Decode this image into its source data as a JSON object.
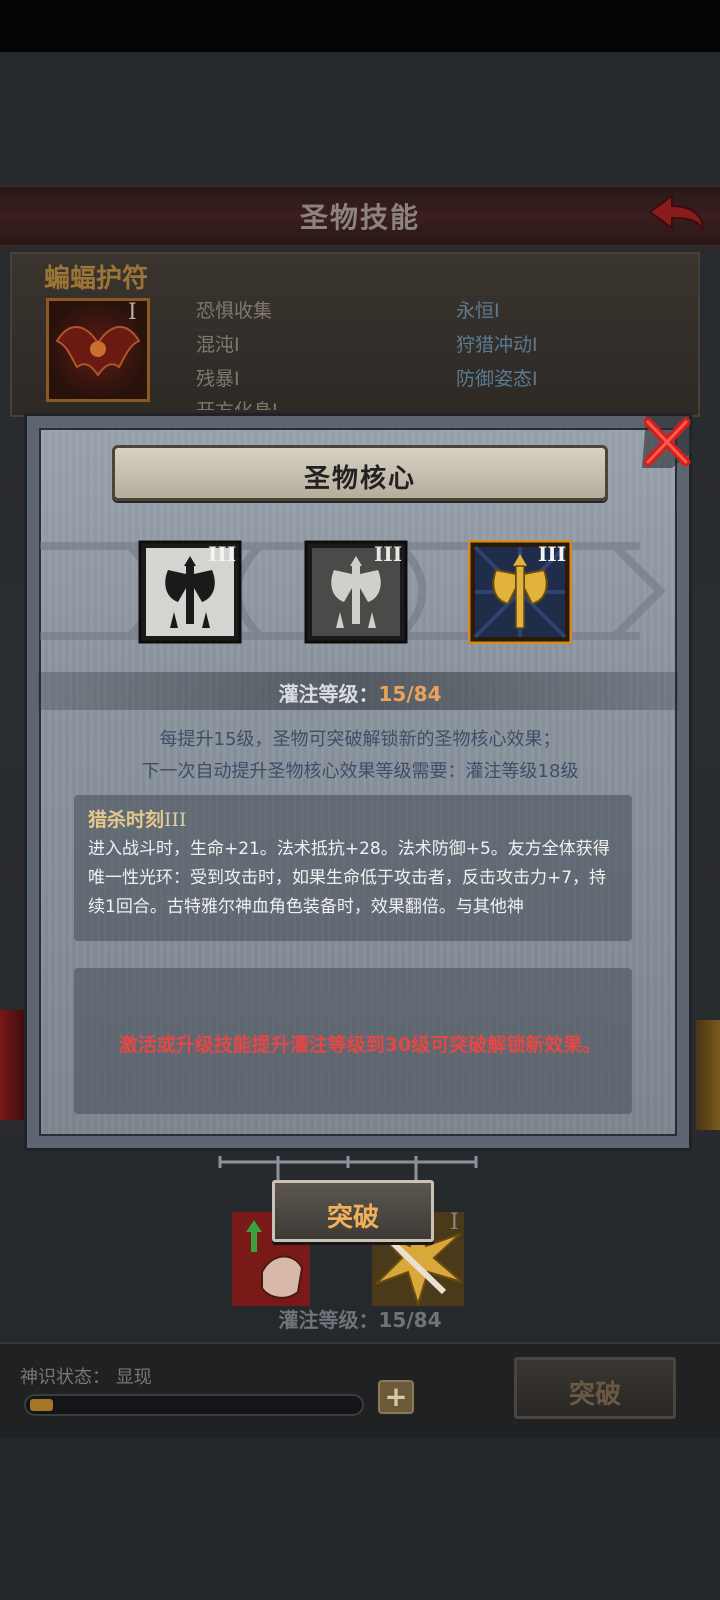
{
  "screen": {
    "title": "圣物技能",
    "item_name": "蝙蝠护符",
    "item_level": "I",
    "skills": [
      {
        "label": "恐惧收集"
      },
      {
        "label": "永恒I"
      },
      {
        "label": "混沌I"
      },
      {
        "label": "狩猎冲动I"
      },
      {
        "label": "残暴I"
      },
      {
        "label": "防御姿态I"
      },
      {
        "label": "开方化身I"
      }
    ],
    "left_skill_level": "I",
    "infusion_label": "灌注等级：15/84",
    "divine_state": "神识状态：  显现",
    "divine_progress": 0.07,
    "plus_label": "+",
    "breakthrough_label": "突破"
  },
  "modal": {
    "title": "圣物核心",
    "cores": [
      {
        "level": "III",
        "icon": "axe-icon",
        "state": "inactive"
      },
      {
        "level": "III",
        "icon": "axe-icon",
        "state": "inactive"
      },
      {
        "level": "III",
        "icon": "axe-icon",
        "state": "selected"
      }
    ],
    "infusion_prefix": "灌注等级：",
    "infusion_value": "15/84",
    "desc_line1": "每提升15级，圣物可突破解锁新的圣物核心效果；",
    "desc_line2": "下一次自动提升圣物核心效果等级需要：灌注等级18级",
    "effect": {
      "name": "猎杀时刻",
      "level": "III",
      "text": "进入战斗时，生命+21。法术抵抗+28。法术防御+5。友方全体获得唯一性光环：受到攻击时，如果生命低于攻击者，反击攻击力+7，持续1回合。古特雅尔神血角色装备时，效果翻倍。与其他神"
    },
    "locked_text": "激活或升级技能提升灌注等级到30级可突破解锁新效果。",
    "breakthrough_label": "突破"
  },
  "colors": {
    "accent_orange": "#e9a35a",
    "locked_red": "#e34845",
    "effect_title": "#e5c98c",
    "desc_blue": "#3d4e66"
  }
}
